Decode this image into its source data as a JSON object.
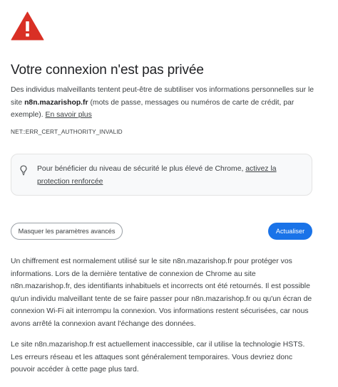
{
  "heading": {
    "title": "Votre connexion n'est pas privée"
  },
  "intro": {
    "text_before": "Des individus malveillants tentent peut-être de subtiliser vos informations personnelles sur le site ",
    "site": "n8n.mazarishop.fr",
    "text_after": " (mots de passe, messages ou numéros de carte de crédit, par exemple).",
    "learn_more_label": "En savoir plus"
  },
  "error_code": "NET::ERR_CERT_AUTHORITY_INVALID",
  "tip": {
    "text": "Pour bénéficier du niveau de sécurité le plus élevé de Chrome, ",
    "link_label": "activez la protection renforcée"
  },
  "buttons": {
    "advanced_label": "Masquer les paramètres avancés",
    "reload_label": "Actualiser"
  },
  "details": {
    "paragraph_1": "Un chiffrement est normalement utilisé sur le site n8n.mazarishop.fr pour protéger vos informations. Lors de la dernière tentative de connexion de Chrome au site n8n.mazarishop.fr, des identifiants inhabituels et incorrects ont été retournés. Il est possible qu'un individu malveillant tente de se faire passer pour n8n.mazarishop.fr ou qu'un écran de connexion Wi-Fi ait interrompu la connexion. Vos informations restent sécurisées, car nous avons arrêté la connexion avant l'échange des données.",
    "paragraph_2": "Le site n8n.mazarishop.fr est actuellement inaccessible, car il utilise la technologie HSTS. Les erreurs réseau et les attaques sont généralement temporaires. Vous devriez donc pouvoir accéder à cette page plus tard."
  },
  "colors": {
    "warning_red": "#d93025",
    "accent_blue": "#1a73e8",
    "text": "#3c4043"
  },
  "icons": {
    "warning": "warning-triangle-icon",
    "tip": "lightbulb-icon"
  }
}
